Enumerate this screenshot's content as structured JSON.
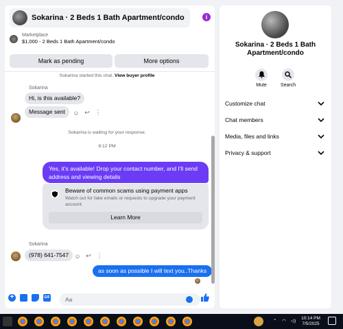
{
  "chat": {
    "title": "Sokarina · 2 Beds 1 Bath Apartment/condo",
    "marketplace_label": "Marketplace",
    "marketplace_item": "$1,000 - 2 Beds 1 Bath Apartment/condo",
    "mark_pending": "Mark as pending",
    "more_options": "More options",
    "started_note": "Sokarina started this chat.",
    "view_profile": "View buyer profile",
    "sender1": "Sokarina",
    "msg1": "Hi, is this available?",
    "msg2": "Message sent",
    "waiting_note": "Sokarina is waiting for your response.",
    "time_note": "8:12 PM",
    "reply_msg": "Yes, it's available! Drop your contact number, and I'll send address and viewing details",
    "warn_title": "Beware of common scams using payment apps",
    "warn_desc": "Watch out for fake emails or requests to upgrade your payment account.",
    "learn_more": "Learn More",
    "sender2": "Sokarina",
    "msg3": "(978) 641-7547",
    "msg4": "as soon as possible I will text you..Thanks",
    "composer_placeholder": "Aa"
  },
  "info": {
    "name": "Sokarina · 2 Beds 1 Bath Apartment/condo",
    "mute": "Mute",
    "search": "Search",
    "rows": [
      "Customize chat",
      "Chat members",
      "Media, files and links",
      "Privacy & support"
    ]
  },
  "taskbar": {
    "time": "10:14 PM",
    "date": "7/5/2025"
  },
  "colors": {
    "accent_blue": "#1a70f0",
    "purple": "#6b3bf6",
    "info_icon": "#9b27d6"
  }
}
